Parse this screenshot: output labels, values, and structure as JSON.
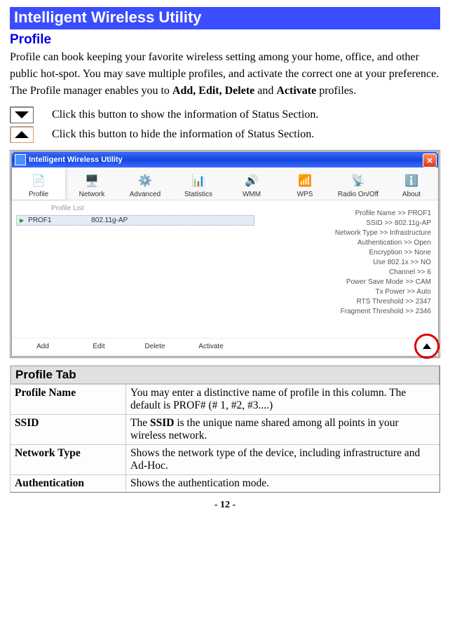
{
  "banner": "Intelligent Wireless Utility",
  "heading": "Profile",
  "intro_pre": "Profile can book keeping your favorite wireless setting among your home, office, and other public hot-spot. You may save multiple profiles, and activate the correct one at your preference. The Profile manager enables you to ",
  "intro_bold1": "Add, Edit, Delete",
  "intro_mid": " and ",
  "intro_bold2": "Activate",
  "intro_post": " profiles.",
  "btn_down_desc": "Click this button to show the information of Status Section.",
  "btn_up_desc": "Click this button to hide the information of Status Section.",
  "win": {
    "title": "Intelligent Wireless Utility",
    "tabs": [
      "Profile",
      "Network",
      "Advanced",
      "Statistics",
      "WMM",
      "WPS",
      "Radio On/Off",
      "About"
    ],
    "list_header": "Profile List",
    "row": {
      "name": "PROF1",
      "ap": "802.11g-AP"
    },
    "details": {
      "pn": "Profile Name >> PROF1",
      "ss": "SSID >> 802.11g-AP",
      "nt": "Network Type >> Infrastructure",
      "au": "Authentication >> Open",
      "en": "Encryption >> None",
      "ux": "Use 802.1x >> NO",
      "ch": "Channel >> 6",
      "ps": "Power Save Mode >> CAM",
      "tx": "Tx Power >> Auto",
      "rt": "RTS Threshold >> 2347",
      "ft": "Fragment Threshold >> 2346"
    },
    "acts": {
      "add": "Add",
      "edit": "Edit",
      "del": "Delete",
      "act": "Activate"
    }
  },
  "tab_header": "Profile Tab",
  "rows": {
    "r1l": "Profile Name",
    "r1r": "You may enter a distinctive name of profile in this column. The default is PROF# (# 1, #2, #3....)",
    "r2l": "SSID",
    "r2r_pre": "The ",
    "r2r_b": "SSID",
    "r2r_post": " is the unique name shared among all points in your wireless network.",
    "r3l": "Network Type",
    "r3r": "Shows the network type of the device, including infrastructure and Ad-Hoc.",
    "r4l": "Authentication",
    "r4r": "Shows the authentication mode."
  },
  "page": "- 12 -"
}
